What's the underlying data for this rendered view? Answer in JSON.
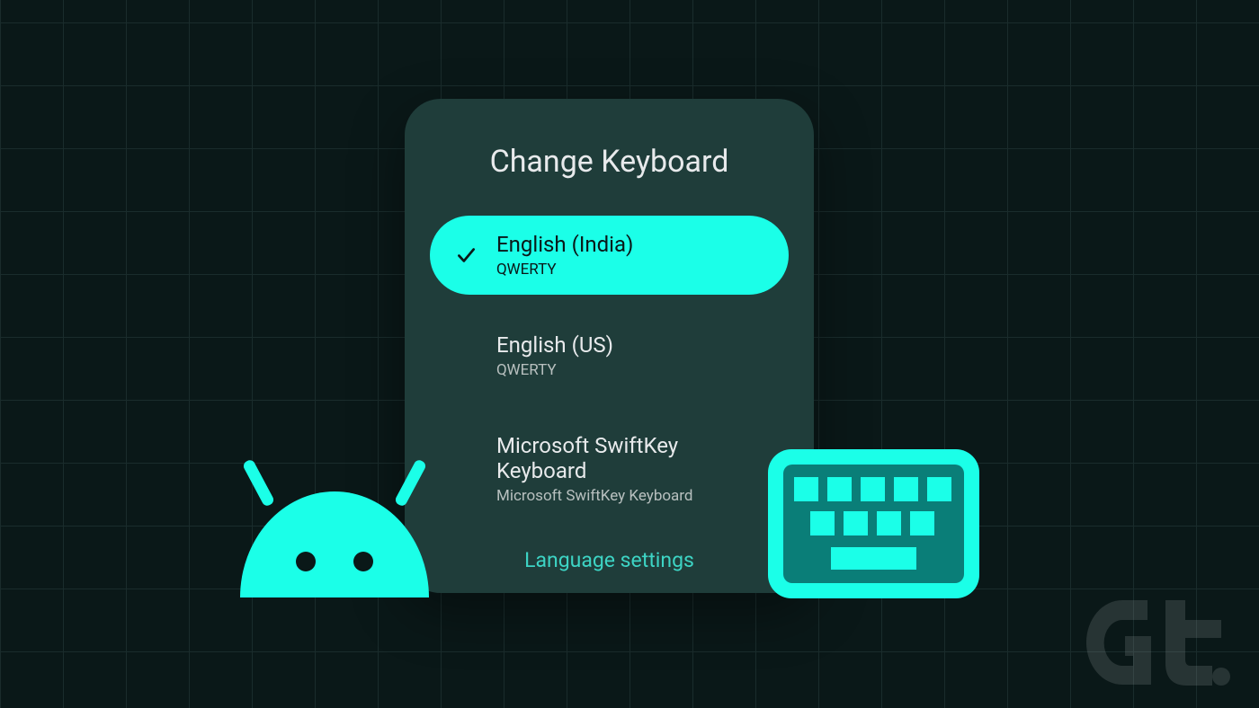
{
  "dialog": {
    "title": "Change Keyboard",
    "options": [
      {
        "label": "English (India)",
        "sublabel": "QWERTY",
        "selected": true
      },
      {
        "label": "English (US)",
        "sublabel": "QWERTY",
        "selected": false
      },
      {
        "label": "Microsoft SwiftKey Keyboard",
        "sublabel": "Microsoft SwiftKey Keyboard",
        "selected": false
      }
    ],
    "settings_link": "Language settings"
  },
  "colors": {
    "accent": "#1bffe8",
    "dialog_bg": "#1f3d3a",
    "page_bg": "#0a1818"
  }
}
